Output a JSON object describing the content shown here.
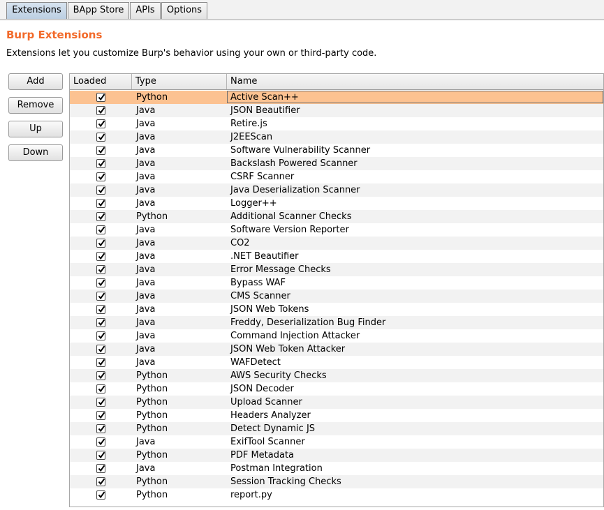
{
  "tabs": [
    {
      "label": "Extensions",
      "active": true
    },
    {
      "label": "BApp Store",
      "active": false
    },
    {
      "label": "APIs",
      "active": false
    },
    {
      "label": "Options",
      "active": false
    }
  ],
  "header": {
    "title": "Burp Extensions",
    "description": "Extensions let you customize Burp's behavior using your own or third-party code."
  },
  "buttons": {
    "add": "Add",
    "remove": "Remove",
    "up": "Up",
    "down": "Down"
  },
  "table": {
    "columns": {
      "loaded": "Loaded",
      "type": "Type",
      "name": "Name"
    },
    "rows": [
      {
        "loaded": true,
        "type": "Python",
        "name": "Active Scan++",
        "selected": true
      },
      {
        "loaded": true,
        "type": "Java",
        "name": "JSON Beautifier"
      },
      {
        "loaded": true,
        "type": "Java",
        "name": "Retire.js"
      },
      {
        "loaded": true,
        "type": "Java",
        "name": "J2EEScan"
      },
      {
        "loaded": true,
        "type": "Java",
        "name": "Software Vulnerability Scanner"
      },
      {
        "loaded": true,
        "type": "Java",
        "name": "Backslash Powered Scanner"
      },
      {
        "loaded": true,
        "type": "Java",
        "name": "CSRF Scanner"
      },
      {
        "loaded": true,
        "type": "Java",
        "name": "Java Deserialization Scanner"
      },
      {
        "loaded": true,
        "type": "Java",
        "name": "Logger++"
      },
      {
        "loaded": true,
        "type": "Python",
        "name": "Additional Scanner Checks"
      },
      {
        "loaded": true,
        "type": "Java",
        "name": "Software Version Reporter"
      },
      {
        "loaded": true,
        "type": "Java",
        "name": "CO2"
      },
      {
        "loaded": true,
        "type": "Java",
        "name": ".NET Beautifier"
      },
      {
        "loaded": true,
        "type": "Java",
        "name": "Error Message Checks"
      },
      {
        "loaded": true,
        "type": "Java",
        "name": "Bypass WAF"
      },
      {
        "loaded": true,
        "type": "Java",
        "name": "CMS Scanner"
      },
      {
        "loaded": true,
        "type": "Java",
        "name": "JSON Web Tokens"
      },
      {
        "loaded": true,
        "type": "Java",
        "name": "Freddy, Deserialization Bug Finder"
      },
      {
        "loaded": true,
        "type": "Java",
        "name": "Command Injection Attacker"
      },
      {
        "loaded": true,
        "type": "Java",
        "name": "JSON Web Token Attacker"
      },
      {
        "loaded": true,
        "type": "Java",
        "name": "WAFDetect"
      },
      {
        "loaded": true,
        "type": "Python",
        "name": "AWS Security Checks"
      },
      {
        "loaded": true,
        "type": "Python",
        "name": "JSON Decoder"
      },
      {
        "loaded": true,
        "type": "Python",
        "name": "Upload Scanner"
      },
      {
        "loaded": true,
        "type": "Python",
        "name": "Headers Analyzer"
      },
      {
        "loaded": true,
        "type": "Python",
        "name": "Detect Dynamic JS"
      },
      {
        "loaded": true,
        "type": "Java",
        "name": "ExifTool Scanner"
      },
      {
        "loaded": true,
        "type": "Python",
        "name": "PDF Metadata"
      },
      {
        "loaded": true,
        "type": "Java",
        "name": "Postman Integration"
      },
      {
        "loaded": true,
        "type": "Python",
        "name": "Session Tracking Checks"
      },
      {
        "loaded": true,
        "type": "Python",
        "name": "report.py"
      }
    ]
  },
  "colors": {
    "title": "#f26a2a",
    "selected_row": "#fcc291",
    "active_tab": "#c8d8e8"
  }
}
